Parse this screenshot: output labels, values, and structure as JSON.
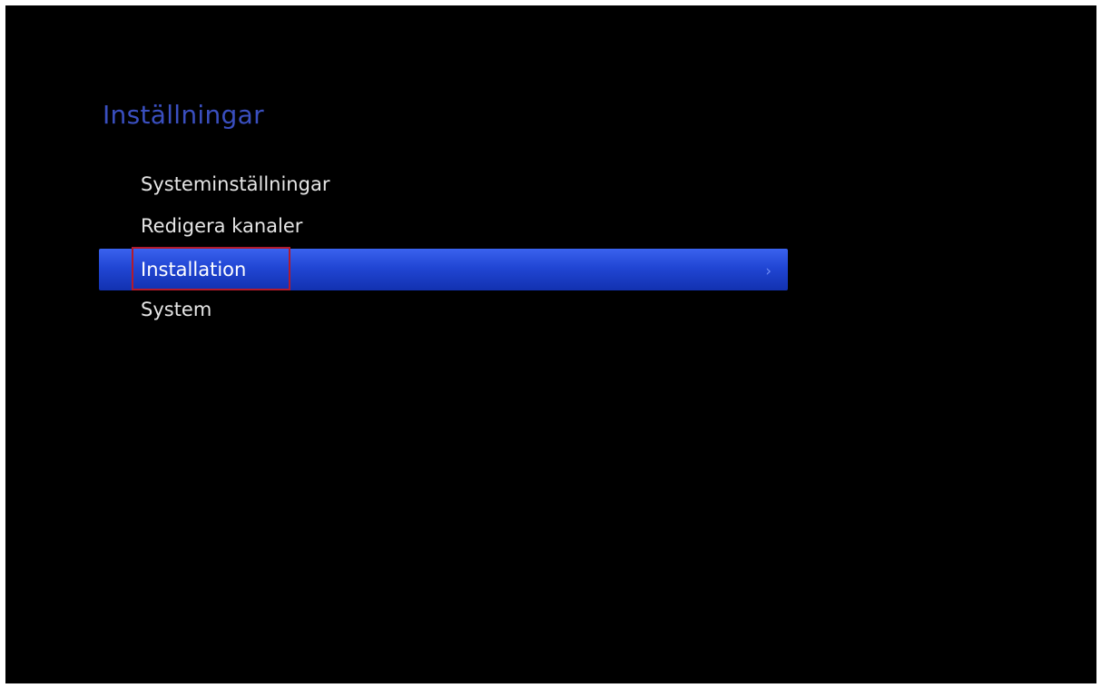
{
  "screen": {
    "title": "Inställningar"
  },
  "menu": {
    "items": [
      {
        "label": "Systeminställningar"
      },
      {
        "label": "Redigera kanaler"
      },
      {
        "label": "Installation"
      },
      {
        "label": "System"
      }
    ],
    "selected_index": 2
  },
  "icons": {
    "submenu": "chevron-right-icon"
  },
  "colors": {
    "title": "#3a4fc0",
    "highlight": "#2146d4",
    "focus_outline": "#b31a2c",
    "background": "#000000"
  }
}
